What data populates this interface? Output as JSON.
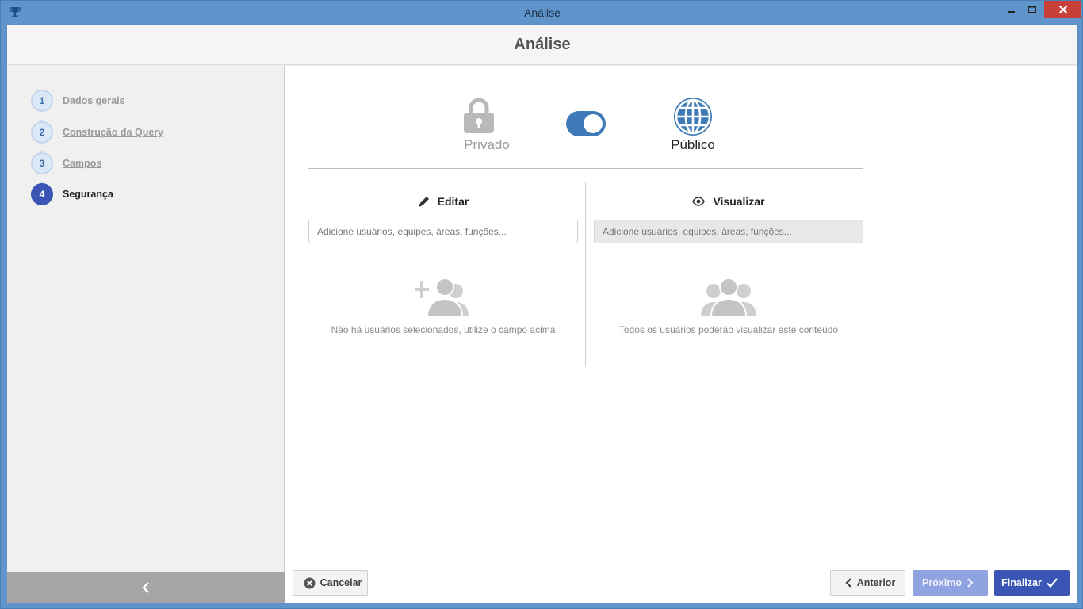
{
  "window": {
    "title": "Análise",
    "app_icon": "trophy-icon",
    "controls": {
      "minimize": "minimize-icon",
      "maximize": "maximize-icon",
      "close": "close-icon"
    }
  },
  "header": {
    "title": "Análise"
  },
  "sidebar": {
    "steps": [
      {
        "number": "1",
        "label": "Dados gerais",
        "state": "done"
      },
      {
        "number": "2",
        "label": "Construção da Query",
        "state": "done"
      },
      {
        "number": "3",
        "label": "Campos",
        "state": "done"
      },
      {
        "number": "4",
        "label": "Segurança",
        "state": "active"
      }
    ],
    "collapse_icon": "chevron-left-icon"
  },
  "privacy": {
    "private_label": "Privado",
    "public_label": "Público",
    "toggle_state": "public",
    "private_icon": "lock-icon",
    "public_icon": "globe-icon"
  },
  "edit_panel": {
    "heading": "Editar",
    "icon": "pencil-icon",
    "input_placeholder": "Adicione usuários, equipes, áreas, funções...",
    "empty_icon": "add-users-icon",
    "empty_text": "Não há usuários selecionados, utilize o campo acima"
  },
  "view_panel": {
    "heading": "Visualizar",
    "icon": "eye-icon",
    "input_placeholder": "Adicione usuários, equipes, áreas, funções...",
    "input_disabled": true,
    "empty_icon": "users-icon",
    "empty_text": "Todos os usuários poderão visualizar este conteúdo"
  },
  "footer": {
    "cancel_label": "Cancelar",
    "prev_label": "Anterior",
    "next_label": "Próximo",
    "finish_label": "Finalizar"
  },
  "colors": {
    "accent": "#3a55b3",
    "toggle": "#3f7ab8",
    "next_disabled": "#8fa3e0",
    "titlebar": "#5f95cb"
  }
}
